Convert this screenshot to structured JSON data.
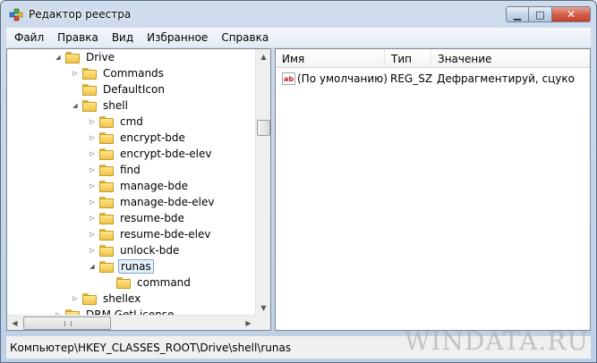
{
  "window": {
    "title": "Редактор реестра"
  },
  "titlebar": {
    "minimize_glyph": "▁",
    "maximize_glyph": "□",
    "close_glyph": "✕"
  },
  "menu": {
    "items": [
      "Файл",
      "Правка",
      "Вид",
      "Избранное",
      "Справка"
    ]
  },
  "tree": {
    "nodes": [
      {
        "label": "Drive",
        "depth": 0,
        "expander": "◢"
      },
      {
        "label": "Commands",
        "depth": 1,
        "expander": "▷"
      },
      {
        "label": "DefaultIcon",
        "depth": 1,
        "expander": ""
      },
      {
        "label": "shell",
        "depth": 1,
        "expander": "◢"
      },
      {
        "label": "cmd",
        "depth": 2,
        "expander": "▷"
      },
      {
        "label": "encrypt-bde",
        "depth": 2,
        "expander": "▷"
      },
      {
        "label": "encrypt-bde-elev",
        "depth": 2,
        "expander": "▷"
      },
      {
        "label": "find",
        "depth": 2,
        "expander": "▷"
      },
      {
        "label": "manage-bde",
        "depth": 2,
        "expander": "▷"
      },
      {
        "label": "manage-bde-elev",
        "depth": 2,
        "expander": "▷"
      },
      {
        "label": "resume-bde",
        "depth": 2,
        "expander": "▷"
      },
      {
        "label": "resume-bde-elev",
        "depth": 2,
        "expander": "▷"
      },
      {
        "label": "unlock-bde",
        "depth": 2,
        "expander": "▷"
      },
      {
        "label": "runas",
        "depth": 2,
        "expander": "◢",
        "selected": true
      },
      {
        "label": "command",
        "depth": 3,
        "expander": ""
      },
      {
        "label": "shellex",
        "depth": 1,
        "expander": "▷"
      },
      {
        "label": "DRM.GetLicense",
        "depth": 0,
        "expander": "▷"
      }
    ]
  },
  "list": {
    "columns": [
      "Имя",
      "Тип",
      "Значение"
    ],
    "rows": [
      {
        "icon": "ab",
        "name": "(По умолчанию)",
        "type": "REG_SZ",
        "value": "Дефрагментируй, сцуко"
      }
    ]
  },
  "statusbar": {
    "path": "Компьютер\\HKEY_CLASSES_ROOT\\Drive\\shell\\runas"
  },
  "watermark": "WINDATA.RU",
  "colors": {
    "selection_bg": "#e5f1fb",
    "selection_border": "#7da2ce",
    "folder": "#f0c24a"
  }
}
